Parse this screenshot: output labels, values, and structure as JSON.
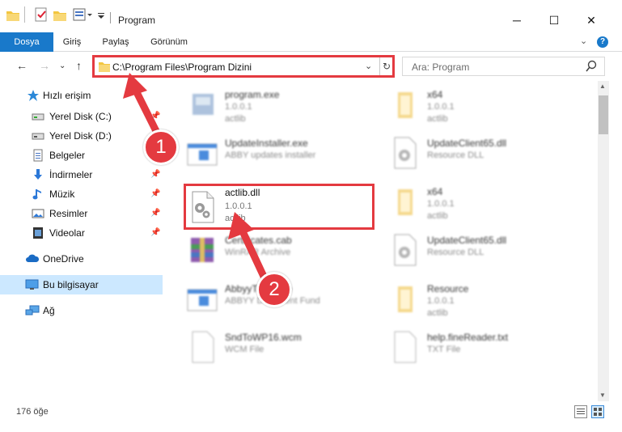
{
  "window": {
    "title": "Program",
    "minimize": "─",
    "maximize": "☐",
    "close": "✕"
  },
  "ribbon": {
    "tabs": [
      "Dosya",
      "Giriş",
      "Paylaş",
      "Görünüm"
    ],
    "active_tab": "Dosya",
    "help": "?"
  },
  "nav": {
    "address_path": "C:\\Program Files\\Program Dizini",
    "search_placeholder": "Ara: Program"
  },
  "sidebar": {
    "items": [
      {
        "label": "Hızlı erişim",
        "icon": "star-icon"
      },
      {
        "label": "Yerel Disk (C:)",
        "icon": "drive-icon",
        "pinned": true
      },
      {
        "label": "Yerel Disk (D:)",
        "icon": "drive-icon"
      },
      {
        "label": "Belgeler",
        "icon": "documents-icon",
        "pinned": true
      },
      {
        "label": "İndirmeler",
        "icon": "download-icon",
        "pinned": true
      },
      {
        "label": "Müzik",
        "icon": "music-icon",
        "pinned": true
      },
      {
        "label": "Resimler",
        "icon": "pictures-icon",
        "pinned": true
      },
      {
        "label": "Videolar",
        "icon": "videos-icon",
        "pinned": true
      },
      {
        "label": "OneDrive",
        "icon": "cloud-icon"
      },
      {
        "label": "Bu bilgisayar",
        "icon": "computer-icon",
        "selected": true
      },
      {
        "label": "Ağ",
        "icon": "network-icon"
      }
    ]
  },
  "files": [
    {
      "name": "program.exe",
      "line2": "1.0.0.1",
      "line3": "actlib",
      "icon": "exe-icon"
    },
    {
      "name": "x64",
      "line2": "1.0.0.1",
      "line3": "actlib",
      "icon": "folder-icon"
    },
    {
      "name": "UpdateInstaller.exe",
      "line2": "ABBY updates installer",
      "line3": "",
      "icon": "window-icon"
    },
    {
      "name": "UpdateClient65.dll",
      "line2": "Resource DLL",
      "line3": "",
      "icon": "dll-icon"
    },
    {
      "name": "actlib.dll",
      "line2": "1.0.0.1",
      "line3": "actlib",
      "icon": "dll-icon",
      "highlighted": true
    },
    {
      "name": "x64",
      "line2": "1.0.0.1",
      "line3": "actlib",
      "icon": "folder-icon"
    },
    {
      "name": "Certificates.cab",
      "line2": "WinRAR Archive",
      "line3": "",
      "icon": "archive-icon"
    },
    {
      "name": "UpdateClient65.dll",
      "line2": "Resource DLL",
      "line3": "",
      "icon": "dll-icon"
    },
    {
      "name": "AbbyyTranslate",
      "line2": "ABBYY Document Fund",
      "line3": "",
      "icon": "window-icon"
    },
    {
      "name": "Resource",
      "line2": "1.0.0.1",
      "line3": "actlib",
      "icon": "folder-icon"
    },
    {
      "name": "SndToWP16.wcm",
      "line2": "WCM File",
      "line3": "",
      "icon": "blank-file-icon"
    },
    {
      "name": "help.fineReader.txt",
      "line2": "TXT File",
      "line3": "",
      "icon": "blank-file-icon"
    }
  ],
  "status": {
    "item_count": "176 öğe"
  },
  "callouts": {
    "one": "1",
    "two": "2",
    "color": "#e43a40"
  },
  "colors": {
    "accent": "#1979ca",
    "selection": "#cce8ff",
    "highlight": "#e43a40"
  }
}
